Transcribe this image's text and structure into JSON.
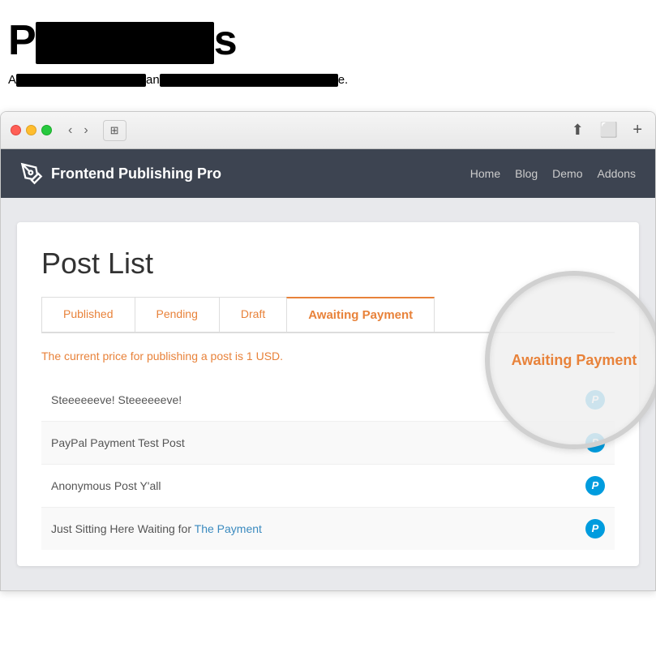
{
  "page": {
    "title_start": "P",
    "title_end": "s",
    "subtitle": "Add... and... e."
  },
  "browser": {
    "back_label": "‹",
    "forward_label": "›",
    "sidebar_label": "⊞",
    "share_label": "⬆",
    "fullscreen_label": "⬜",
    "addtab_label": "+"
  },
  "sitenav": {
    "logo_text": "Frontend Publishing Pro",
    "links": [
      "Home",
      "Blog",
      "Demo",
      "Addons"
    ]
  },
  "postlist": {
    "title": "Post List",
    "tabs": [
      {
        "label": "Published",
        "active": false
      },
      {
        "label": "Pending",
        "active": false
      },
      {
        "label": "Draft",
        "active": false
      },
      {
        "label": "Awaiting Payment",
        "active": true
      }
    ],
    "price_notice": "The current price for publishing a post is 1 USD.",
    "posts": [
      {
        "title": "Steeeeeeve! Steeeeeeve!"
      },
      {
        "title": "PayPal Payment Test Post"
      },
      {
        "title": "Anonymous Post Y'all"
      },
      {
        "title": "Just Sitting Here Waiting for The Payment"
      }
    ]
  }
}
